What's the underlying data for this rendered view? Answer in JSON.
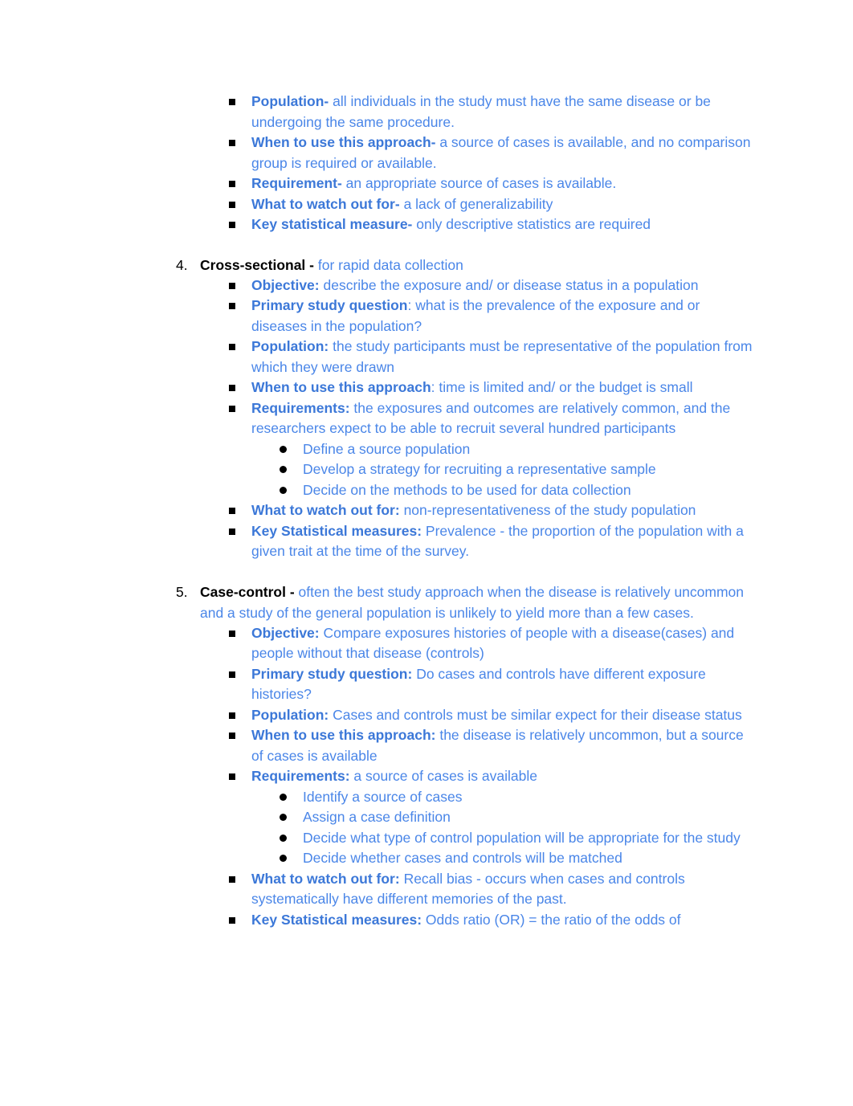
{
  "document": {
    "text_color_blue": "#4a86e8",
    "bold_blue": "#3c78d8",
    "text_color_black": "#000000",
    "background": "#ffffff"
  },
  "sections": {
    "cohort_tail": {
      "items": [
        {
          "lead": "Population-",
          "rest": " all individuals in the study must have the same disease or be undergoing the same procedure."
        },
        {
          "lead": "When to use this approach-",
          "rest": " a source of cases is available, and no comparison group is required or available."
        },
        {
          "lead": "Requirement-",
          "rest": " an appropriate source of cases is available."
        },
        {
          "lead": "What to watch out for-",
          "rest": " a lack of generalizability"
        },
        {
          "lead": "Key statistical measure-",
          "rest": " only descriptive statistics are required"
        }
      ]
    },
    "cross_sectional": {
      "number": "4.",
      "title": "Cross-sectional - ",
      "title_rest": "for rapid data collection",
      "items": [
        {
          "lead": "Objective:",
          "rest": " describe the exposure and/ or disease status in a population"
        },
        {
          "lead": "Primary study question",
          "rest": ": what is the prevalence of the exposure and or diseases in the population?"
        },
        {
          "lead": "Population:",
          "rest": " the study participants must be representative of the population from which they were drawn"
        },
        {
          "lead": "When to use this approach",
          "rest": ": time is limited and/ or the budget is small"
        },
        {
          "lead": "Requirements:",
          "rest": " the exposures and outcomes are relatively common, and the researchers expect to be able to recruit several hundred participants",
          "subitems": [
            "Define a source population",
            "Develop a strategy for recruiting a representative sample",
            "Decide on the methods to be used for data collection"
          ]
        },
        {
          "lead": "What to watch out for:",
          "rest": " non-representativeness of the study population"
        },
        {
          "lead": "Key Statistical measures:",
          "rest": " Prevalence - the proportion of the population with a given trait at the time of the survey."
        }
      ]
    },
    "case_control": {
      "number": "5.",
      "title": "Case-control - ",
      "title_rest": "often the best study approach when the disease is relatively uncommon and a study of the general population is unlikely to yield more than a few cases.",
      "items": [
        {
          "lead": "Objective:",
          "rest": " Compare exposures histories of people with a disease(cases) and people without that disease (controls)"
        },
        {
          "lead": "Primary study question:",
          "rest": " Do cases and controls have different exposure histories?"
        },
        {
          "lead": "Population:",
          "rest": " Cases and controls must be similar expect for their disease status"
        },
        {
          "lead": "When to use this approach:",
          "rest": " the disease is relatively uncommon, but a source of cases is available"
        },
        {
          "lead": "Requirements:",
          "rest": " a source of cases is available",
          "subitems": [
            "Identify a source of cases",
            "Assign a case definition",
            "Decide what type of control population will be appropriate for the study",
            "Decide whether cases and controls will be matched"
          ]
        },
        {
          "lead": "What to watch out for:",
          "rest": " Recall bias - occurs when cases and controls systematically have different memories of the past."
        },
        {
          "lead": "Key Statistical measures:",
          "rest": " Odds ratio (OR) = the ratio of the odds of"
        }
      ]
    }
  }
}
